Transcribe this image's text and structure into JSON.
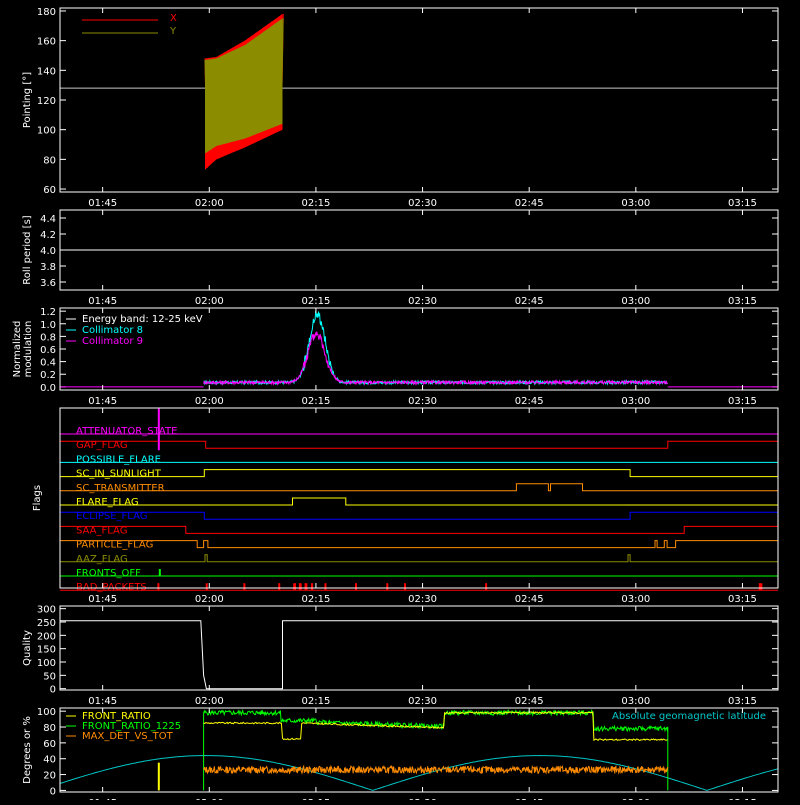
{
  "time_axis": {
    "ticks": [
      "01:45",
      "02:00",
      "02:15",
      "02:30",
      "02:45",
      "03:00",
      "03:15"
    ],
    "tick_minutes": [
      105,
      120,
      135,
      150,
      165,
      180,
      195
    ],
    "range_minutes": [
      99,
      200
    ]
  },
  "colors": {
    "background": "#000000",
    "axes": "#ffffff",
    "x_series": "#ff0000",
    "y_series": "#8c8c00",
    "reference": "#c8c8c8",
    "collimator8": "#00ffff",
    "collimator9": "#ff00ff",
    "front_ratio": "#ffff00",
    "front_ratio_1225": "#00ff00",
    "max_det": "#ff8c00",
    "geomag": "#00c8c8"
  },
  "chart_data": [
    {
      "id": "pointing",
      "type": "line",
      "ylabel": "Pointing [°]",
      "ylim": [
        58,
        182
      ],
      "yticks": [
        60,
        80,
        100,
        120,
        140,
        160,
        180
      ],
      "legend": [
        "X",
        "Y"
      ],
      "reference_line": 128,
      "series": [
        {
          "name": "X",
          "x_start": 119.4,
          "x_end": 130.3,
          "period_min": 0.55,
          "lower": [
            [
              119.4,
              73
            ],
            [
              121,
              80
            ],
            [
              125,
              88
            ],
            [
              130.3,
              100
            ]
          ],
          "upper": [
            [
              119.4,
              148
            ],
            [
              121,
              149
            ],
            [
              125,
              160
            ],
            [
              130.3,
              178
            ]
          ]
        },
        {
          "name": "Y",
          "x_start": 119.4,
          "x_end": 130.3,
          "period_min": 0.55,
          "lower": [
            [
              119.4,
              84
            ],
            [
              121,
              89
            ],
            [
              125,
              94
            ],
            [
              130.3,
              104
            ]
          ],
          "upper": [
            [
              119.4,
              147
            ],
            [
              121,
              148
            ],
            [
              125,
              157
            ],
            [
              130.3,
              175
            ]
          ]
        }
      ]
    },
    {
      "id": "roll",
      "type": "line",
      "ylabel": "Roll period [s]",
      "ylim": [
        3.5,
        4.5
      ],
      "yticks": [
        3.6,
        3.8,
        4.0,
        4.2,
        4.4
      ],
      "value": 4.0
    },
    {
      "id": "modulation",
      "type": "line",
      "ylabel": [
        "Normalized",
        "modulation"
      ],
      "ylim": [
        -0.05,
        1.25
      ],
      "yticks": [
        0.0,
        0.2,
        0.4,
        0.6,
        0.8,
        1.0,
        1.2
      ],
      "legend": [
        "Energy band: 12-25 keV",
        "Collimator 8",
        "Collimator 9"
      ],
      "data_range": [
        119.2,
        184.5
      ],
      "baseline": 0.07,
      "series": [
        {
          "name": "Collimator 8",
          "peak_time": 135.2,
          "peak": 1.15,
          "width": 1.6
        },
        {
          "name": "Collimator 9",
          "peak_time": 135.1,
          "peak": 0.85,
          "width": 1.7
        }
      ]
    },
    {
      "id": "flags",
      "type": "step",
      "ylabel": "Flags",
      "rows": [
        {
          "name": "ATTENUATOR_STATE",
          "color": "#ff00ff",
          "segments": []
        },
        {
          "name": "GAP_FLAG",
          "color": "#ff0000",
          "segments": [
            [
              99,
              119.5
            ],
            [
              184.5,
              200
            ]
          ]
        },
        {
          "name": "POSSIBLE_FLARE",
          "color": "#00ffff",
          "segments": []
        },
        {
          "name": "SC_IN_SUNLIGHT",
          "color": "#ffff00",
          "segments": [
            [
              119.3,
              179.2
            ]
          ]
        },
        {
          "name": "SC_TRANSMITTER",
          "color": "#ff8c00",
          "segments": [
            [
              163.2,
              167.7
            ],
            [
              168,
              172.5
            ]
          ]
        },
        {
          "name": "FLARE_FLAG",
          "color": "#ffff00",
          "segments": [
            [
              131.7,
              139.2
            ]
          ]
        },
        {
          "name": "ECLIPSE_FLAG",
          "color": "#0000ff",
          "segments": [
            [
              99,
              119.3
            ],
            [
              179.2,
              200
            ]
          ]
        },
        {
          "name": "SAA_FLAG",
          "color": "#ff0000",
          "segments": [
            [
              99,
              116.7
            ],
            [
              186.8,
              200
            ]
          ]
        },
        {
          "name": "PARTICLE_FLAG",
          "color": "#ff8c00",
          "segments": [
            [
              99,
              118.3
            ],
            [
              119.2,
              119.8
            ],
            [
              182.7,
              183
            ],
            [
              184,
              184.4
            ],
            [
              185.6,
              200
            ]
          ]
        },
        {
          "name": "AAZ_FLAG",
          "color": "#8c8c00",
          "segments": [
            [
              119.4,
              119.7
            ],
            [
              178.9,
              179.2
            ]
          ]
        },
        {
          "name": "FRONTS_OFF",
          "color": "#00ff00",
          "segments": [
            [
              112.9,
              113.1
            ]
          ]
        },
        {
          "name": "BAD_PACKETS",
          "color": "#ff0000",
          "segments": [
            [
              112.7,
              112.9
            ],
            [
              119.5,
              119.7
            ],
            [
              124.8,
              125
            ],
            [
              129.7,
              129.9
            ],
            [
              131.8,
              132.2
            ],
            [
              132.6,
              133
            ],
            [
              133.4,
              133.8
            ],
            [
              134.3,
              134.6
            ],
            [
              136.2,
              136.4
            ],
            [
              140.5,
              140.7
            ],
            [
              144.9,
              145.1
            ],
            [
              147.4,
              147.6
            ],
            [
              158.8,
              159
            ],
            [
              197.3,
              197.8
            ]
          ]
        }
      ],
      "attenuator_spike": 112.9
    },
    {
      "id": "quality",
      "type": "line",
      "ylabel": "Quality",
      "ylim": [
        -5,
        310
      ],
      "yticks": [
        0,
        50,
        100,
        150,
        200,
        250,
        300
      ],
      "segments": [
        [
          [
            99,
            255
          ],
          [
            118.8,
            255
          ],
          [
            119.2,
            50
          ],
          [
            119.6,
            0
          ],
          [
            130.3,
            0
          ],
          [
            130.3,
            255
          ],
          [
            200,
            255
          ]
        ]
      ]
    },
    {
      "id": "ratios",
      "type": "line",
      "ylabel": "Degrees or %",
      "ylim": [
        -2,
        104
      ],
      "yticks": [
        0,
        20,
        40,
        60,
        80,
        100
      ],
      "legend": [
        "FRONT_RATIO",
        "FRONT_RATIO_1225",
        "MAX_DET_VS_TOT"
      ],
      "legend_right": "Absolute geomagnetic latitude",
      "data_range": [
        119.2,
        184.5
      ],
      "geomag": {
        "period_min": 47,
        "amplitude": 44,
        "phase_peak_time": 119.5
      }
    }
  ]
}
